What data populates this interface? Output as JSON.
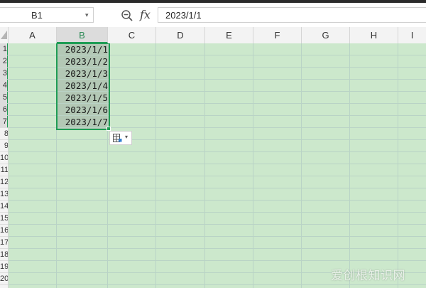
{
  "formula_bar": {
    "name_box": "B1",
    "fx_label": "fx",
    "formula_value": "2023/1/1"
  },
  "columns": [
    {
      "label": "A"
    },
    {
      "label": "B",
      "selected": true
    },
    {
      "label": "C"
    },
    {
      "label": "D"
    },
    {
      "label": "E"
    },
    {
      "label": "F"
    },
    {
      "label": "G"
    },
    {
      "label": "H"
    },
    {
      "label": "I"
    }
  ],
  "rows": [
    {
      "label": "1",
      "selected": true
    },
    {
      "label": "2",
      "selected": true
    },
    {
      "label": "3",
      "selected": true
    },
    {
      "label": "4",
      "selected": true
    },
    {
      "label": "5",
      "selected": true
    },
    {
      "label": "6",
      "selected": true
    },
    {
      "label": "7",
      "selected": true
    },
    {
      "label": "8"
    },
    {
      "label": "9"
    },
    {
      "label": "10"
    },
    {
      "label": "11"
    },
    {
      "label": "12"
    },
    {
      "label": "13"
    },
    {
      "label": "14"
    },
    {
      "label": "15"
    },
    {
      "label": "16"
    },
    {
      "label": "17"
    },
    {
      "label": "18"
    },
    {
      "label": "19"
    },
    {
      "label": "20"
    }
  ],
  "cells": {
    "B": [
      "2023/1/1",
      "2023/1/2",
      "2023/1/3",
      "2023/1/4",
      "2023/1/5",
      "2023/1/6",
      "2023/1/7"
    ]
  },
  "colors": {
    "grid_background": "#cce8cc",
    "selection_border": "#1f9d55",
    "selection_fill": "#b3c8b5"
  },
  "watermark": "爱创根知识网"
}
